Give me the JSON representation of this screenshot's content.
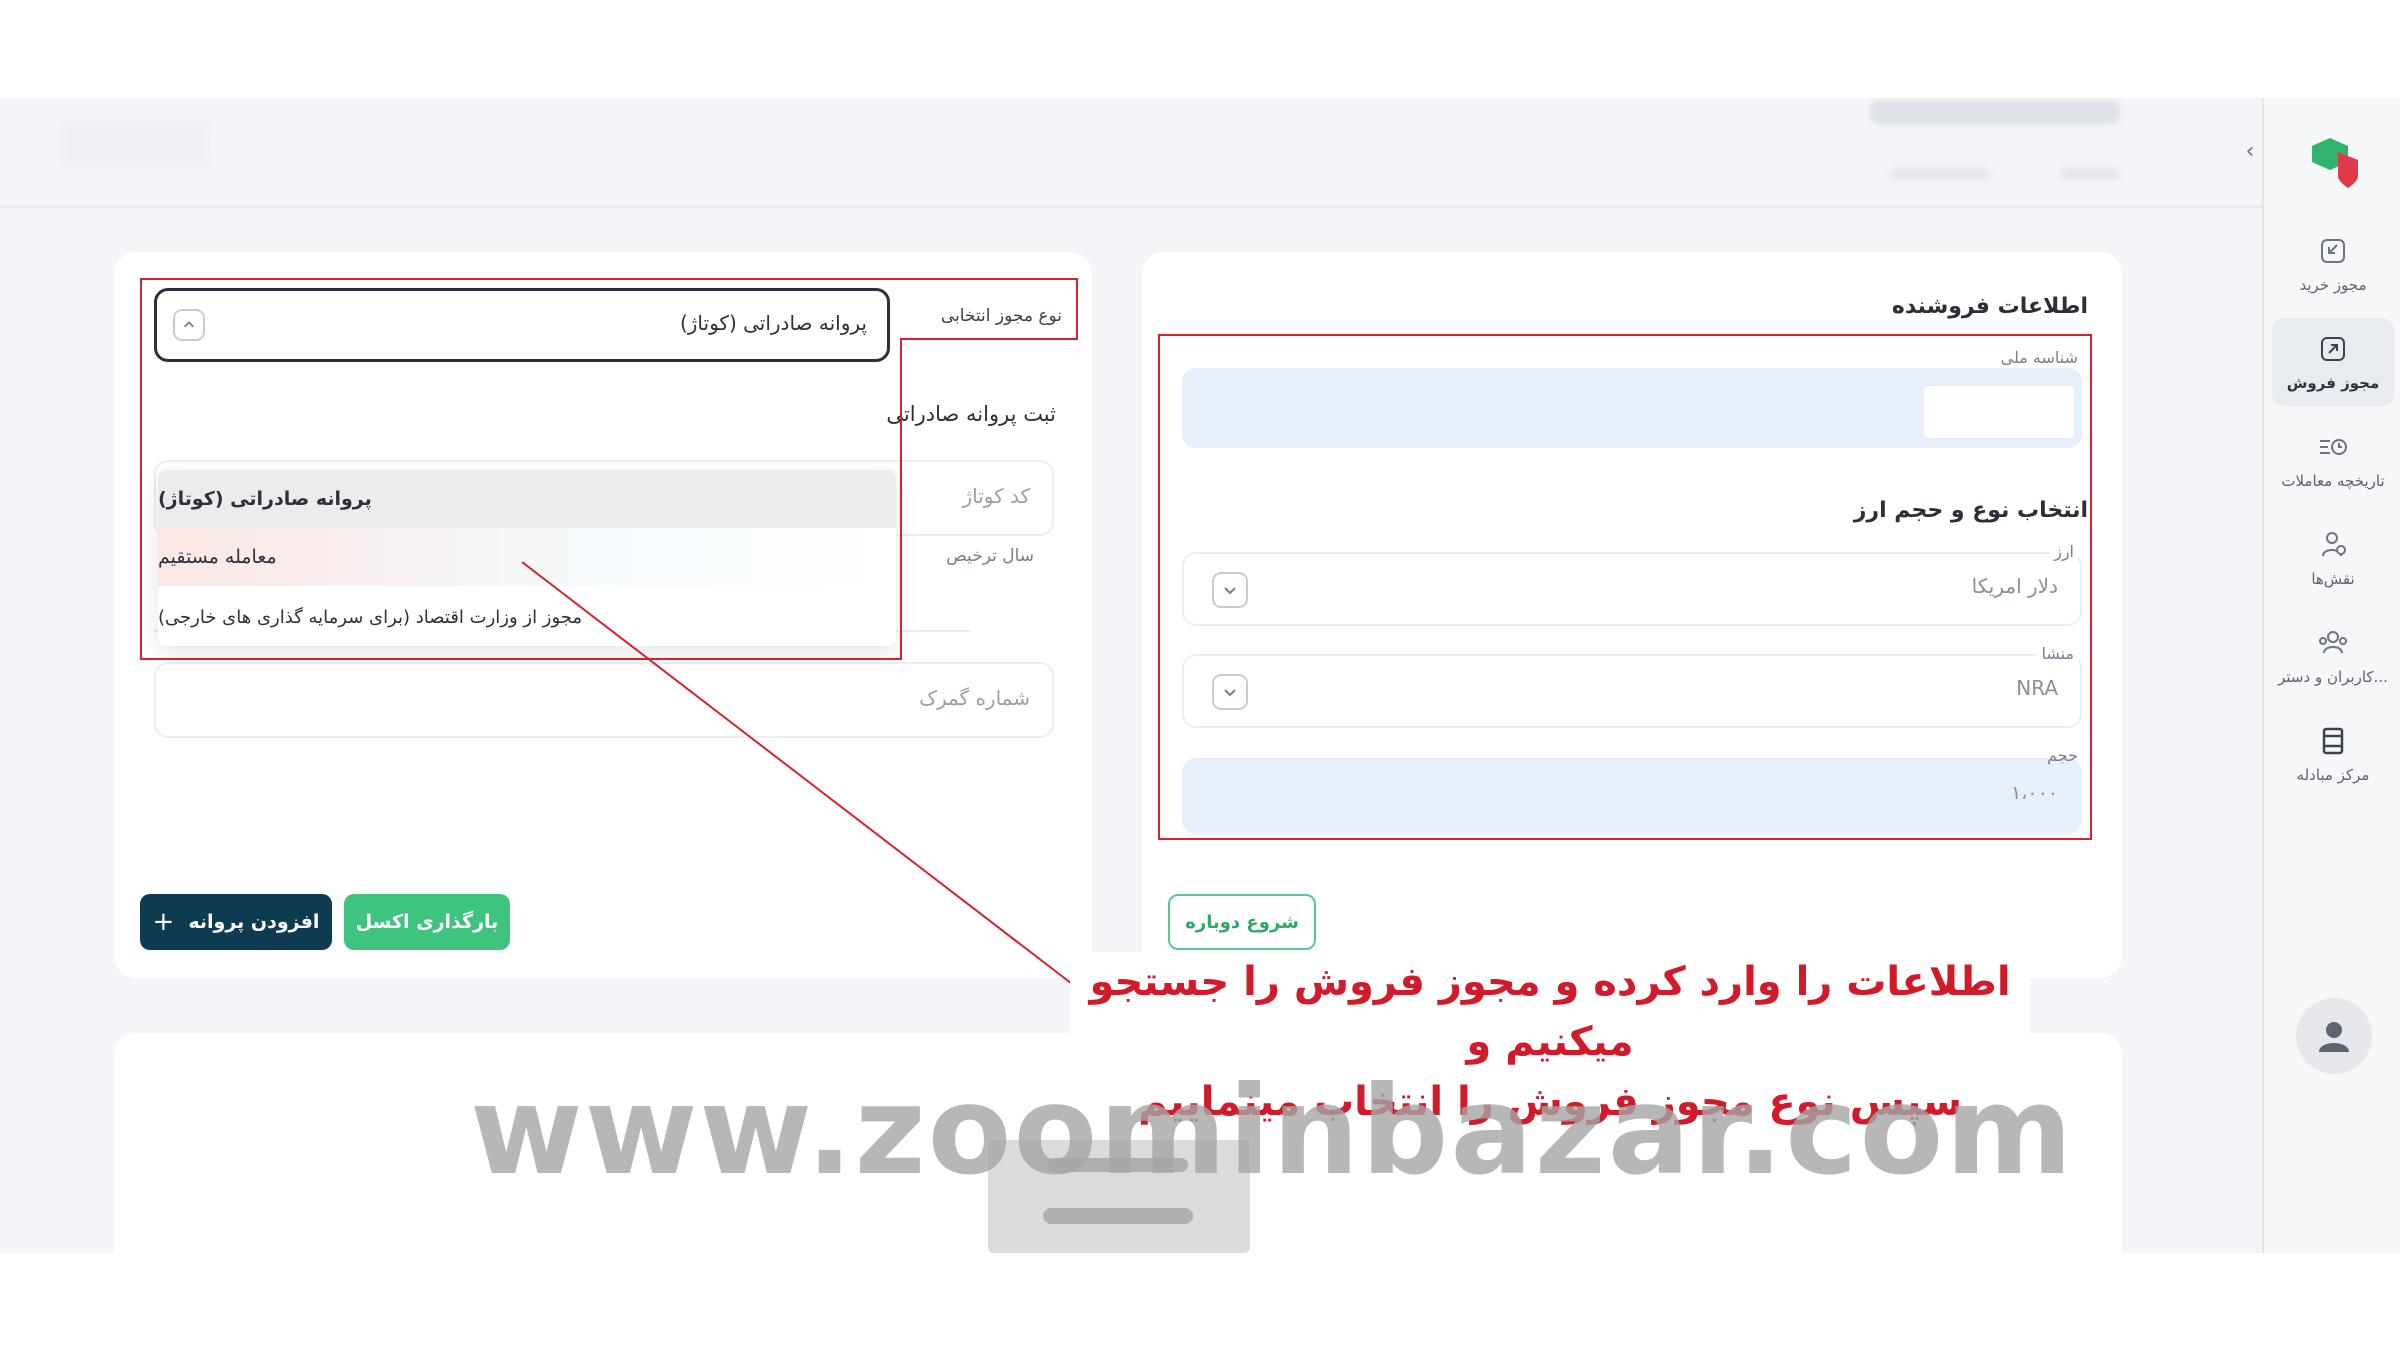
{
  "nav": {
    "items": [
      {
        "label": "مجوز خرید",
        "icon": "buy-license-icon",
        "active": false
      },
      {
        "label": "مجوز فروش",
        "icon": "sell-license-icon",
        "active": true
      },
      {
        "label": "تاریخچه معاملات",
        "icon": "history-icon",
        "active": false
      },
      {
        "label": "نقش‌ها",
        "icon": "roles-icon",
        "active": false
      },
      {
        "label": "کاربران و دستر...",
        "icon": "users-icon",
        "active": false
      },
      {
        "label": "مرکز مبادله",
        "icon": "exchange-center-icon",
        "active": false
      }
    ]
  },
  "seller": {
    "title": "اطلاعات فروشنده",
    "national_id_label": "شناسه ملی",
    "currency_section_title": "انتخاب نوع و حجم ارز",
    "currency_label": "ارز",
    "currency_value": "دلار امریکا",
    "origin_label": "منشا",
    "origin_value": "NRA",
    "volume_label": "حجم",
    "volume_value": "۱،۰۰۰",
    "restart_button": "شروع دوباره"
  },
  "license": {
    "type_label": "نوع مجوز انتخابی",
    "type_value": "پروانه صادراتی (کوتاژ)",
    "register_title": "ثبت پروانه صادراتی",
    "kotaj_placeholder": "کد کوتاژ",
    "year_label": "سال ترخیص",
    "customs_placeholder": "شماره گمرک",
    "dropdown_options": [
      "پروانه صادراتی (کوتاژ)",
      "معامله مستقیم",
      "مجوز از وزارت اقتصاد (برای سرمایه گذاری های خارجی)"
    ],
    "excel_button": "بارگذاری اکسل",
    "add_button": "افزودن پروانه"
  },
  "annotation": {
    "line1": "اطلاعات را وارد کرده و مجوز فروش را جستجو میکنیم و",
    "line2": "سپس نوع مجوز فروش را انتخاب مینماییم"
  },
  "watermark": "www.zoominbazar.com",
  "colors": {
    "accent_green": "#3ec47f",
    "dark_teal": "#0e3b4f",
    "annotation_red": "#d11a2a",
    "filled_field": "#e7eefc"
  }
}
